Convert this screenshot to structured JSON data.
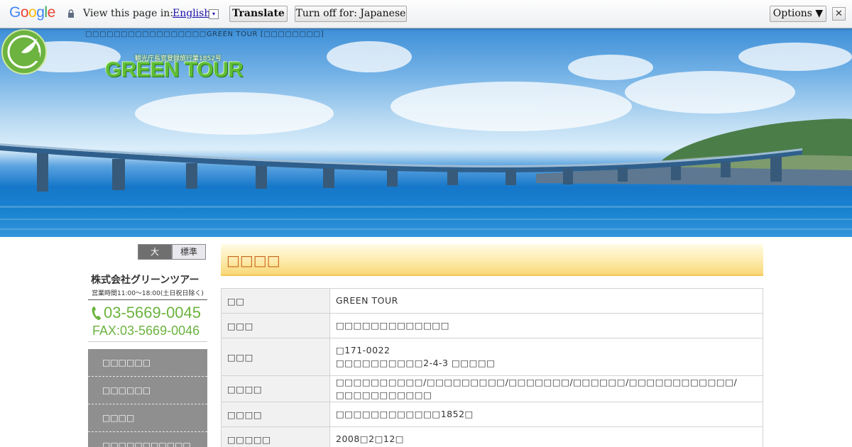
{
  "translate_bar": {
    "logo_text": "Google",
    "view_text": "View this page in:",
    "language": "English",
    "dropdown_glyph": "▾",
    "translate_label": "Translate",
    "turn_off_label": "Turn off for: Japanese",
    "options_label": "Options ▼",
    "close_glyph": "✕"
  },
  "header": {
    "site_description": "□□□□□□□□□□□□□□□□□GREEN TOUR [□□□□□□□□]",
    "logo_subtitle": "観光庁長官登録旅行業1852号",
    "logo_text": "GREEN TOUR"
  },
  "sidebar": {
    "font_large": "大",
    "font_standard": "標準",
    "company_name": "株式会社グリーンツアー",
    "hours": "営業時間11:00〜18:00(土日祝日除く)",
    "tel": "03-5669-0045",
    "fax": "FAX:03-5669-0046",
    "nav": [
      "□□□□□□",
      "□□□□□□",
      "□□□□",
      "□□□□□□□□□□□"
    ]
  },
  "main": {
    "page_title": "□□□□",
    "rows": [
      {
        "label": "□□",
        "lines": [
          "GREEN TOUR"
        ]
      },
      {
        "label": "□□□",
        "lines": [
          "□□□□□□□□□□□□□"
        ]
      },
      {
        "label": "□□□",
        "lines": [
          "□171-0022",
          "□□□□□□□□□□2-4-3 □□□□□"
        ]
      },
      {
        "label": "□□□□",
        "lines": [
          "□□□□□□□□□□/□□□□□□□□□/□□□□□□□/□□□□□□/□□□□□□□□□□□□/□□□□□□□□□□□"
        ]
      },
      {
        "label": "□□□□",
        "lines": [
          "□□□□□□□□□□□□1852□"
        ]
      },
      {
        "label": "□□□□□",
        "lines": [
          "2008□2□12□"
        ]
      }
    ]
  },
  "colors": {
    "accent_green": "#6cb33f",
    "title_orange": "#c9681a",
    "nav_gray": "#8f8f8f"
  }
}
